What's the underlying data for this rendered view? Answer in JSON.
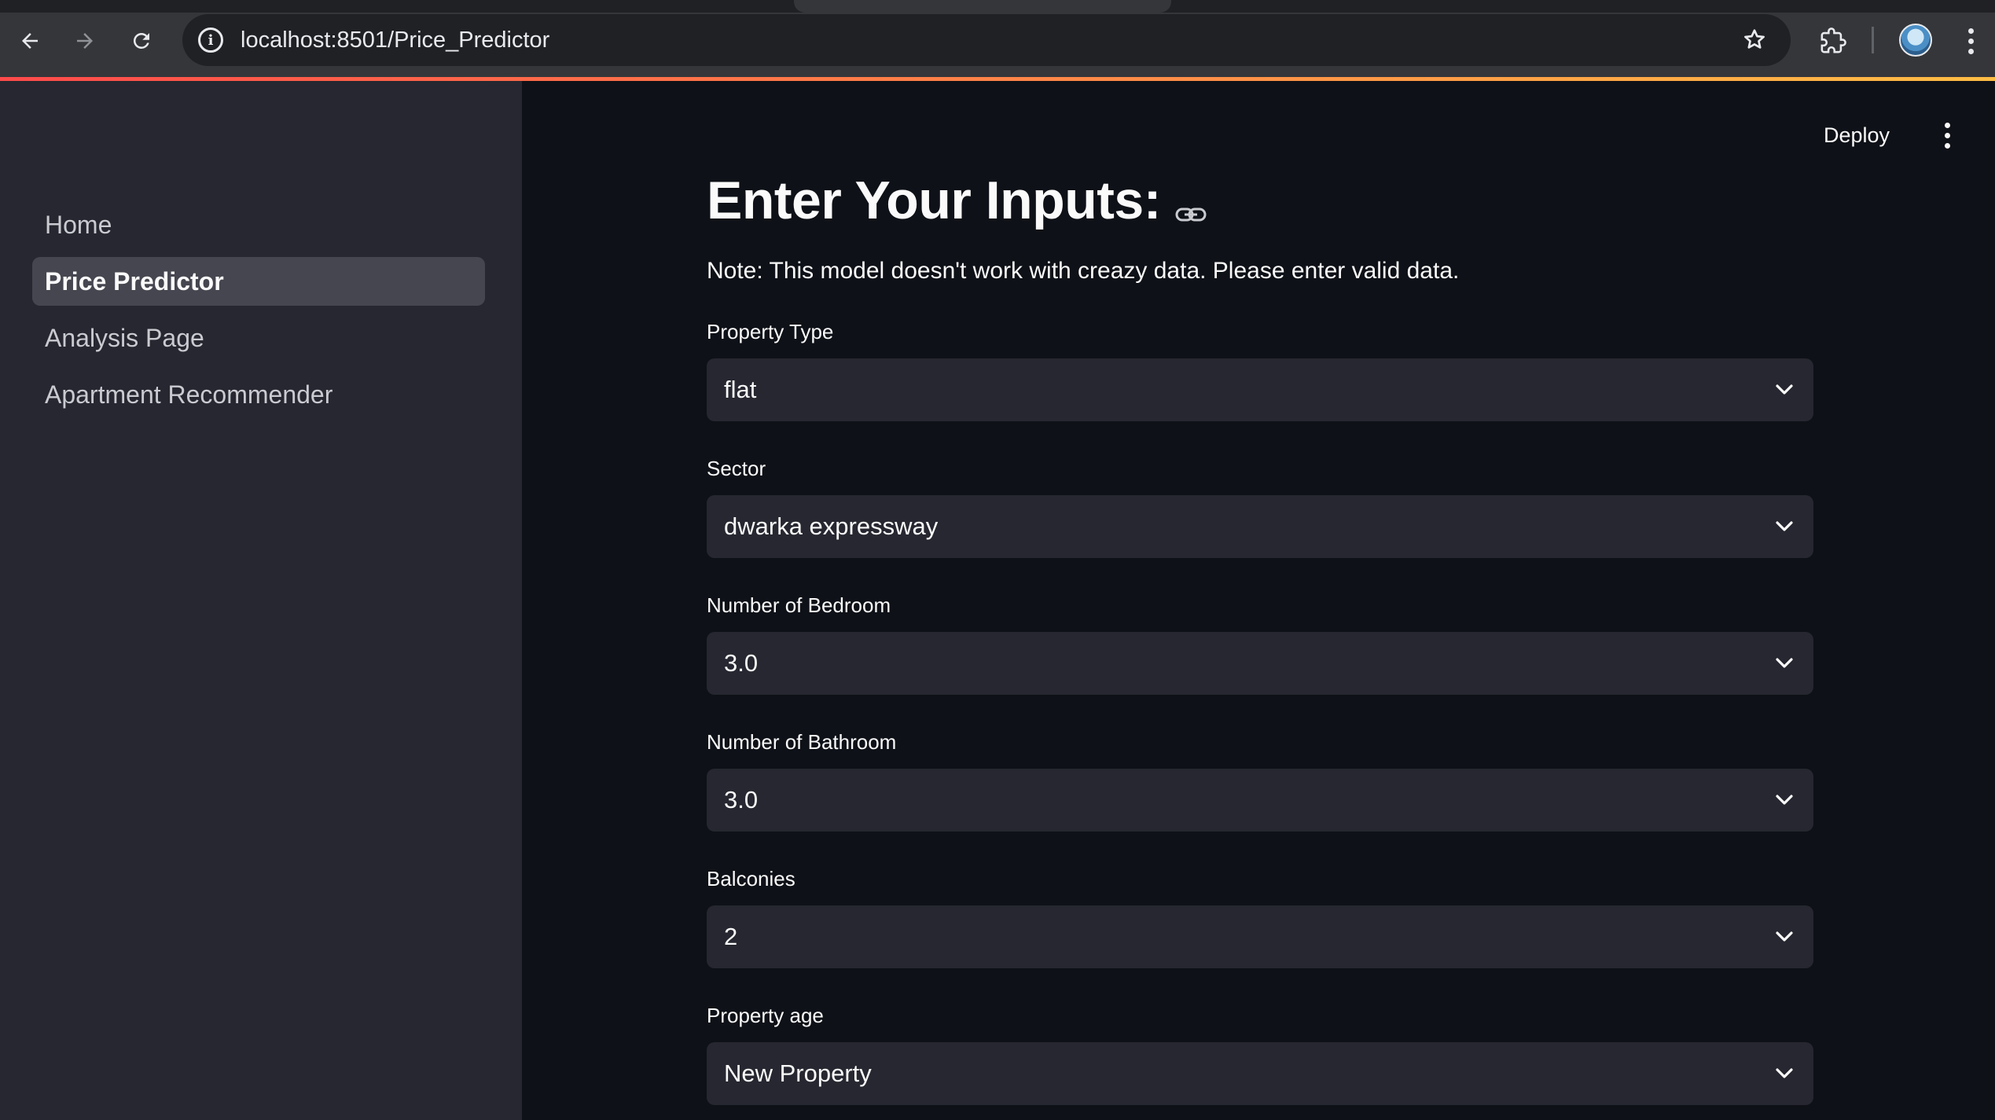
{
  "browser": {
    "url_host": "localhost:8501",
    "url_path": "/Price_Predictor",
    "back_icon": "arrow-left-icon",
    "forward_icon": "arrow-right-icon",
    "reload_icon": "reload-icon"
  },
  "sidebar": {
    "items": [
      {
        "label": "Home"
      },
      {
        "label": "Price Predictor"
      },
      {
        "label": "Analysis Page"
      },
      {
        "label": "Apartment Recommender"
      }
    ],
    "active_index": 1
  },
  "header": {
    "deploy_label": "Deploy"
  },
  "main": {
    "title": "Enter Your Inputs:",
    "note": "Note: This model doesn't work with creazy data. Please enter valid data.",
    "fields": [
      {
        "label": "Property Type",
        "value": "flat"
      },
      {
        "label": "Sector",
        "value": "dwarka expressway"
      },
      {
        "label": "Number of Bedroom",
        "value": "3.0"
      },
      {
        "label": "Number of Bathroom",
        "value": "3.0"
      },
      {
        "label": "Balconies",
        "value": "2"
      },
      {
        "label": "Property age",
        "value": "New Property"
      }
    ]
  },
  "colors": {
    "background": "#0e1117",
    "sidebar": "#262730",
    "accent_start": "#ff4b4b",
    "accent_end": "#ffbd45"
  }
}
